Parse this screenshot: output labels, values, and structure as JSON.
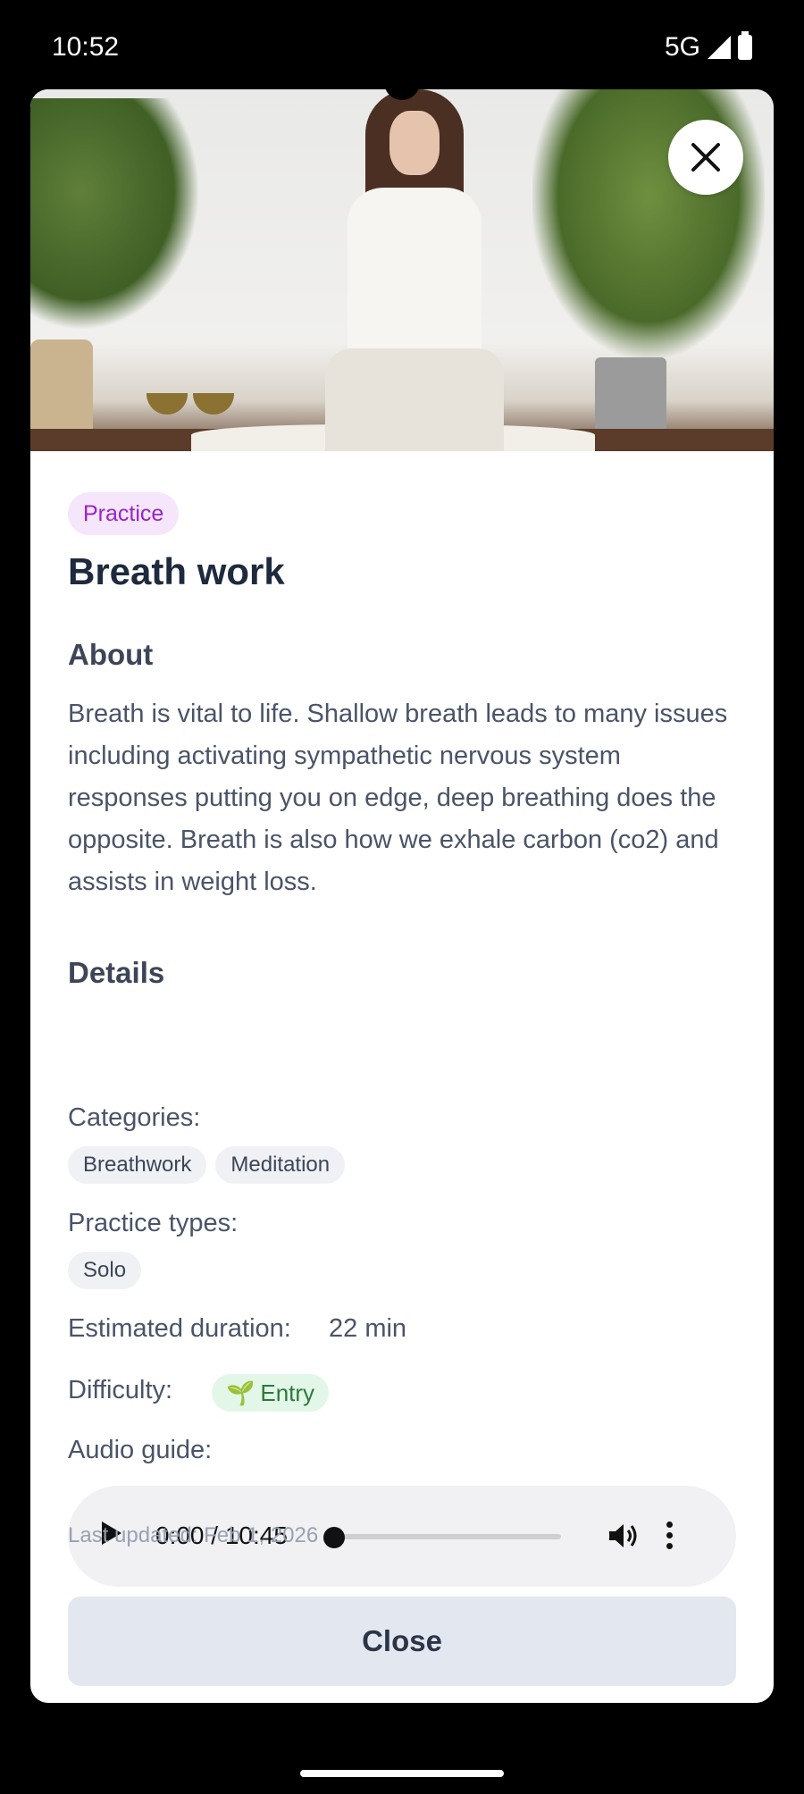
{
  "status_bar": {
    "time": "10:52",
    "network": "5G"
  },
  "tag": "Practice",
  "title": "Breath work",
  "about": {
    "heading": "About",
    "text": "Breath is vital to life. Shallow breath leads to many issues including activating sympathetic nervous system responses putting you on edge, deep breathing does the opposite. Breath is also how we exhale carbon (co2) and assists in weight loss."
  },
  "details": {
    "heading": "Details",
    "categories_label": "Categories:",
    "categories": [
      "Breathwork",
      "Meditation"
    ],
    "practice_types_label": "Practice types:",
    "practice_types": [
      "Solo"
    ],
    "duration_label": "Estimated duration:",
    "duration_value": "22 min",
    "difficulty_label": "Difficulty:",
    "difficulty_emoji": "🌱",
    "difficulty_value": "Entry",
    "audio_label": "Audio guide:"
  },
  "player": {
    "current": "0:00",
    "total": "10:45",
    "time_display": "0:00 / 10:45",
    "progress": 0
  },
  "last_updated": "Last updated: Feb 1, 2026",
  "close_button": "Close",
  "colors": {
    "accent_purple": "#9a23c8",
    "difficulty_green": "#2a7a3b"
  }
}
